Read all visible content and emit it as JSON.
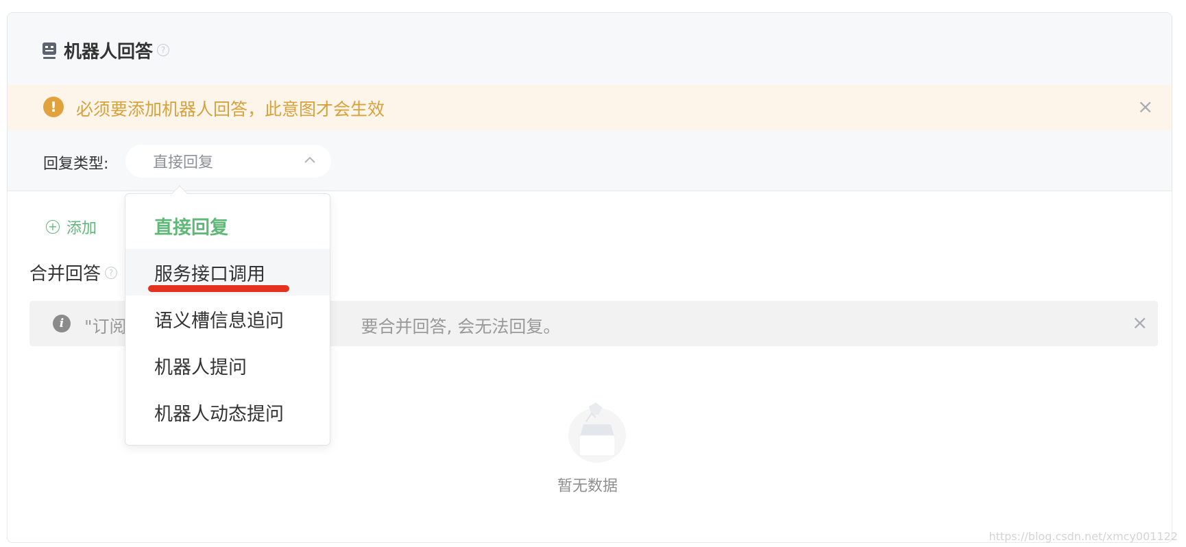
{
  "section": {
    "title": "机器人回答",
    "help": "?"
  },
  "warning": {
    "text": "必须要添加机器人回答，此意图才会生效",
    "icon": "!",
    "close": "×"
  },
  "reply_type": {
    "label": "回复类型:",
    "selected": "直接回复"
  },
  "dropdown": {
    "options": [
      "直接回复",
      "服务接口调用",
      "语义槽信息追问",
      "机器人提问",
      "机器人动态提问"
    ],
    "selected_index": 0,
    "hovered_index": 1
  },
  "add": {
    "label": "添加",
    "icon": "+"
  },
  "merge": {
    "title": "合并回答",
    "help": "?"
  },
  "info": {
    "text_start": "\"订阅",
    "text_end": "要合并回答, 会无法回复。",
    "icon": "i",
    "close": "×"
  },
  "empty": {
    "text": "暂无数据"
  },
  "watermark": "https://blog.csdn.net/xmcy001122",
  "colors": {
    "accent_green": "#5fb878",
    "warning": "#e1a23d",
    "annotation_red": "#e5321f"
  }
}
